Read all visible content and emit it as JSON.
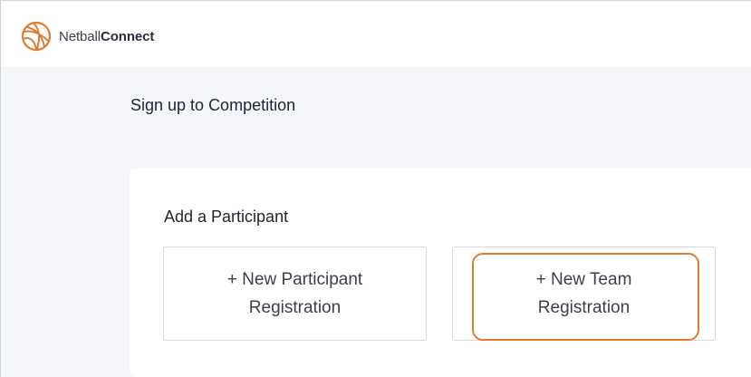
{
  "header": {
    "brand_prefix": "Netball",
    "brand_suffix": "Connect",
    "logo_icon": "netball-icon",
    "accent_color": "#e07b2f"
  },
  "page": {
    "title": "Sign up to Competition"
  },
  "participant_section": {
    "title": "Add a Participant",
    "options": [
      {
        "line1": "+ New Participant",
        "line2": "Registration"
      },
      {
        "line1": "+ New Team",
        "line2": "Registration"
      }
    ]
  }
}
